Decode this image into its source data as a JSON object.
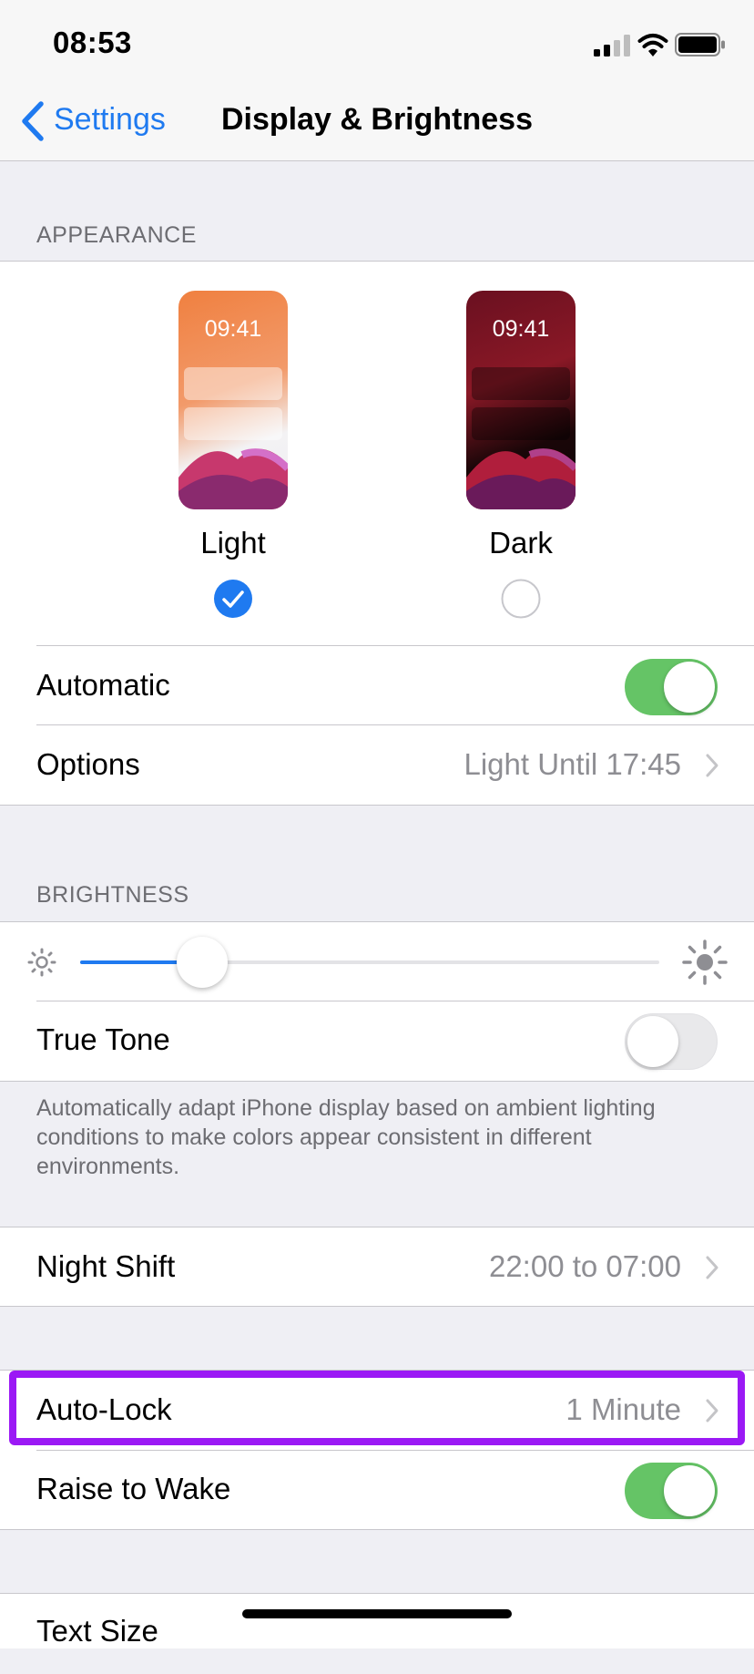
{
  "status_bar": {
    "time": "08:53"
  },
  "nav": {
    "back_label": "Settings",
    "title": "Display & Brightness"
  },
  "appearance": {
    "header": "APPEARANCE",
    "light": {
      "preview_time": "09:41",
      "label": "Light",
      "selected": true
    },
    "dark": {
      "preview_time": "09:41",
      "label": "Dark",
      "selected": false
    },
    "automatic": {
      "label": "Automatic",
      "on": true
    },
    "options": {
      "label": "Options",
      "value": "Light Until 17:45"
    }
  },
  "brightness": {
    "header": "BRIGHTNESS",
    "level": 0.21,
    "true_tone": {
      "label": "True Tone",
      "on": false
    },
    "footnote": "Automatically adapt iPhone display based on ambient lighting conditions to make colors appear consistent in different environments."
  },
  "night_shift": {
    "label": "Night Shift",
    "value": "22:00 to 07:00"
  },
  "auto_lock": {
    "label": "Auto-Lock",
    "value": "1 Minute"
  },
  "raise_to_wake": {
    "label": "Raise to Wake",
    "on": true
  },
  "text_size": {
    "label": "Text Size"
  },
  "colors": {
    "accent": "#1f7af0",
    "toggle_on": "#65c466",
    "highlight": "#9b19f5"
  }
}
